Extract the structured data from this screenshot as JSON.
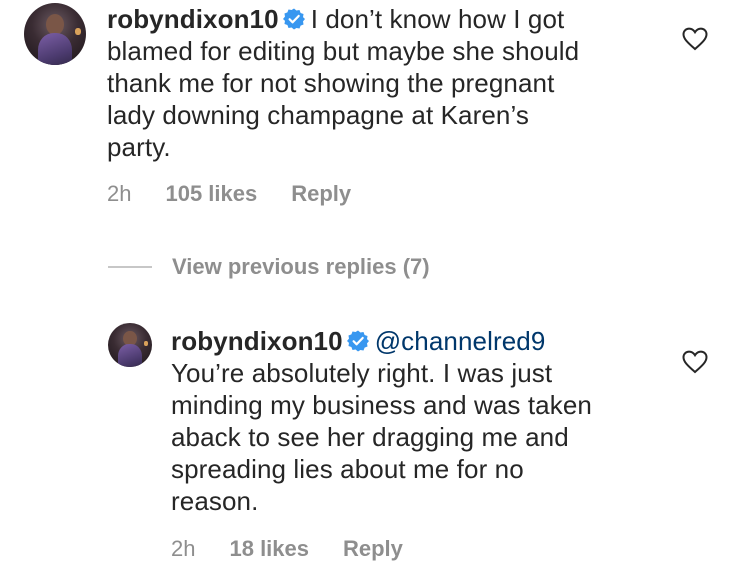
{
  "comments": [
    {
      "username": "robyndixon10",
      "mention": "",
      "text": "I don’t know how I got blamed for editing but maybe she should thank me for not showing the pregnant lady downing champagne at Karen’s party.",
      "line1": "I don’t know how I got",
      "line2": "blamed for editing but maybe she should",
      "line3": "thank me for not showing the pregnant",
      "line4": "lady downing champagne at Karen’s",
      "line5": "party.",
      "time": "2h",
      "likes": "105 likes",
      "reply_label": "Reply"
    },
    {
      "username": "robyndixon10",
      "mention": "@channelred9",
      "line1": "You’re absolutely right. I was just",
      "line2": "minding my business and was taken",
      "line3": "aback to see her dragging me and",
      "line4": "spreading lies about me for no",
      "line5": "reason.",
      "time": "2h",
      "likes": "18 likes",
      "reply_label": "Reply"
    }
  ],
  "view_previous": "View previous replies (7)",
  "icons": {
    "verified": "verified-badge-icon",
    "like": "heart-outline-icon"
  },
  "colors": {
    "text": "#262626",
    "muted": "#8e8e8e",
    "verified": "#3897f0",
    "mention": "#00376b"
  }
}
